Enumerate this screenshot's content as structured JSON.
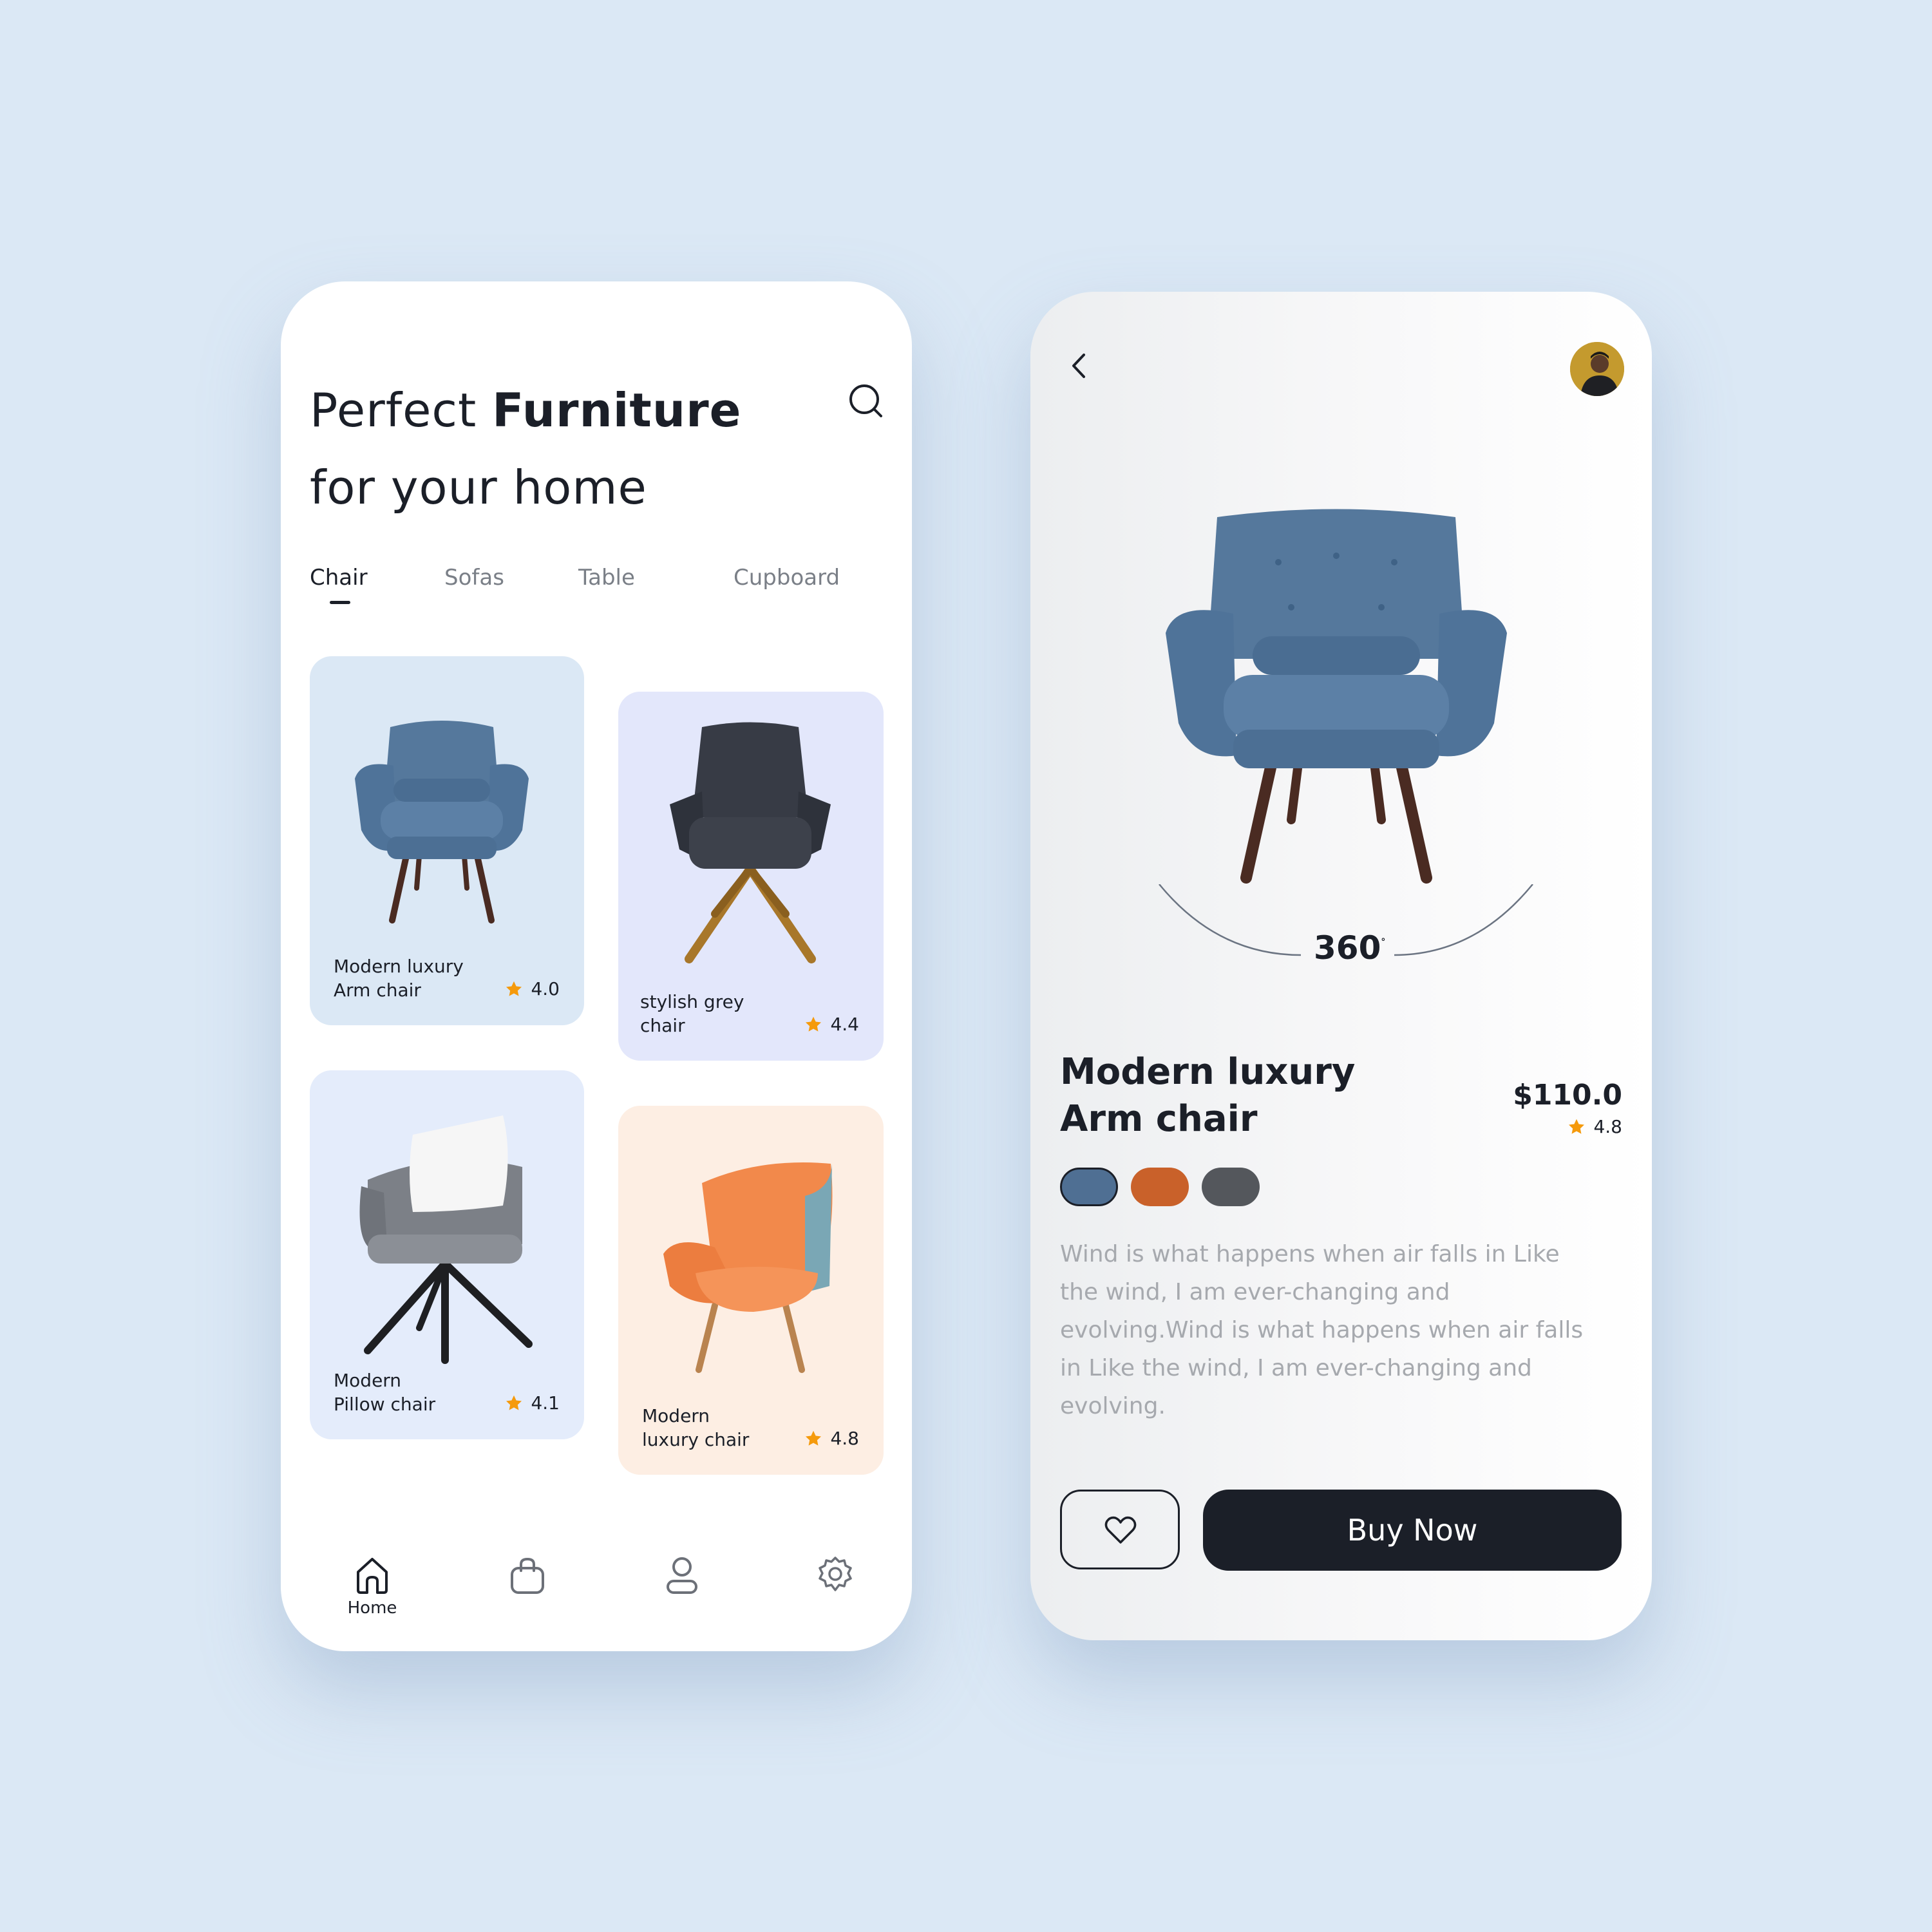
{
  "colors": {
    "page_bg": "#dbe8f5",
    "text_dark": "#1b1f28",
    "star": "#f59a0c",
    "text_muted": "#a6a9ae"
  },
  "home": {
    "headline": {
      "part1": "Perfect ",
      "part2_bold": "Furniture",
      "line2": "for your home"
    },
    "search_icon": "search-icon",
    "tabs": [
      {
        "label": "Chair",
        "active": true
      },
      {
        "label": "Sofas",
        "active": false
      },
      {
        "label": "Table",
        "active": false
      },
      {
        "label": "Cupboard",
        "active": false
      }
    ],
    "products": [
      {
        "name_line1": "Modern luxury",
        "name_line2": "Arm chair",
        "rating": "4.0",
        "bg": "#dbe8f5"
      },
      {
        "name_line1": "stylish grey",
        "name_line2": "chair",
        "rating": "4.4",
        "bg": "#e3e7fb"
      },
      {
        "name_line1": "Modern",
        "name_line2": "Pillow chair",
        "rating": "4.1",
        "bg": "#e4ecfb"
      },
      {
        "name_line1": "Modern",
        "name_line2": "luxury chair",
        "rating": "4.8",
        "bg": "#fdeee3"
      }
    ],
    "nav": [
      {
        "icon": "home-icon",
        "label": "Home",
        "active": true
      },
      {
        "icon": "bag-icon",
        "label": ""
      },
      {
        "icon": "user-icon",
        "label": ""
      },
      {
        "icon": "gear-icon",
        "label": ""
      }
    ]
  },
  "detail": {
    "back_icon": "chevron-left-icon",
    "rotation_label": "360",
    "rotation_suffix": "°",
    "title_line1": "Modern luxury",
    "title_line2": "Arm chair",
    "price": "$110.0",
    "rating": "4.8",
    "swatches": [
      {
        "color": "#4f6f93",
        "selected": true
      },
      {
        "color": "#c9612a",
        "selected": false
      },
      {
        "color": "#54575c",
        "selected": false
      }
    ],
    "description": "Wind is what happens when air falls in  Like the wind, I am ever-changing and evolving.Wind is what happens when air falls in  Like the wind, I am ever-changing and evolving.",
    "favorite_icon": "heart-icon",
    "buy_label": "Buy Now"
  }
}
